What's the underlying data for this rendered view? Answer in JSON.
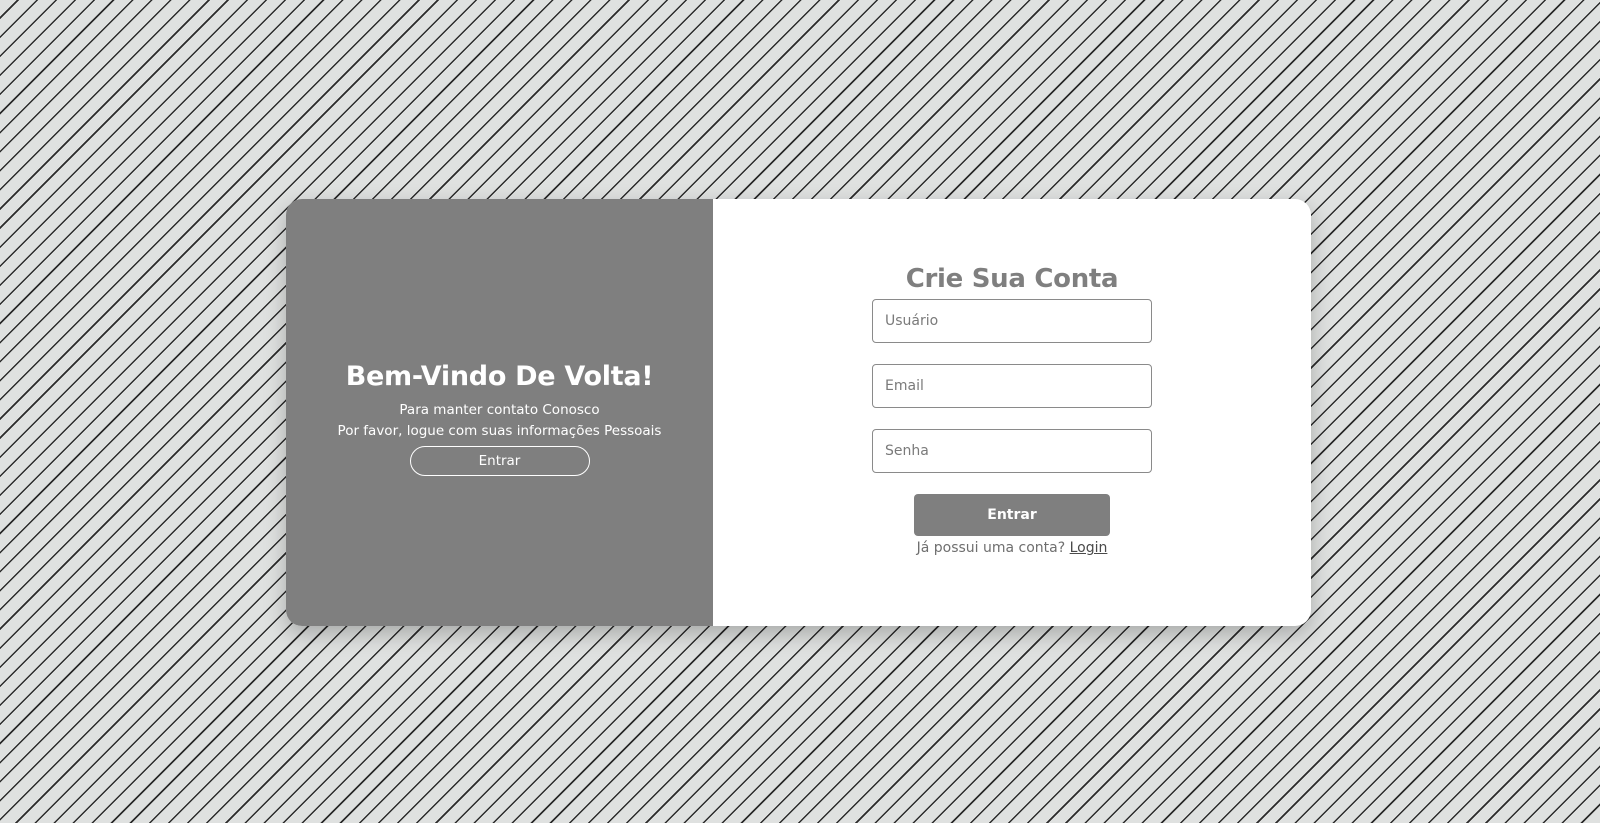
{
  "welcome_panel": {
    "title": "Bem-Vindo De Volta!",
    "line1": "Para manter contato Conosco",
    "line2": "Por favor, logue com suas informações Pessoais",
    "button_label": "Entrar"
  },
  "signup_form": {
    "title": "Crie Sua Conta",
    "username_placeholder": "Usuário",
    "email_placeholder": "Email",
    "password_placeholder": "Senha",
    "submit_label": "Entrar",
    "footer_text": "Já possui uma conta? ",
    "login_link_label": "Login"
  },
  "colors": {
    "panel_gray": "#7f7f7f",
    "background": "#dfe1e0",
    "stripe": "#2b2b2b",
    "card": "#ffffff"
  }
}
